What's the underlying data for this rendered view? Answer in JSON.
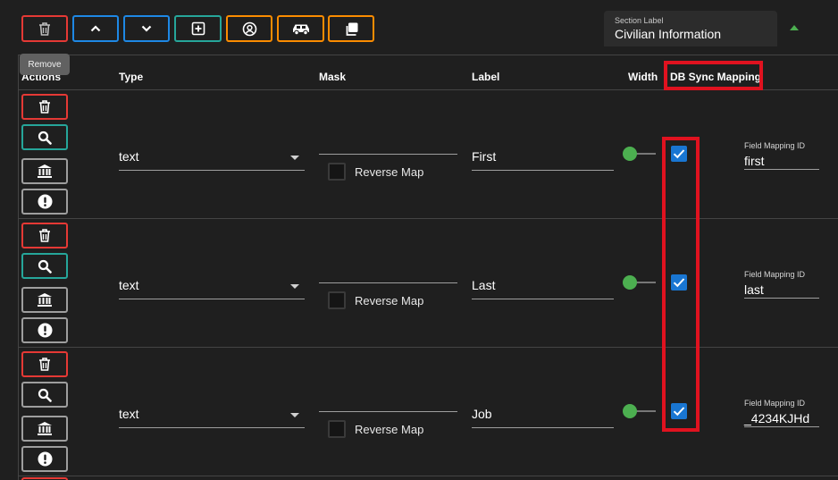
{
  "toolbar": {
    "buttons": [
      {
        "name": "delete-section-button",
        "icon": "trash-icon",
        "color": "#e53935"
      },
      {
        "name": "move-up-button",
        "icon": "chevron-up-icon",
        "color": "#1e88e5"
      },
      {
        "name": "move-down-button",
        "icon": "chevron-down-icon",
        "color": "#1e88e5"
      },
      {
        "name": "add-field-button",
        "icon": "plus-square-icon",
        "color": "#26a69a"
      },
      {
        "name": "person-button",
        "icon": "person-circle-icon",
        "color": "#fb8c00"
      },
      {
        "name": "vehicle-button",
        "icon": "car-icon",
        "color": "#fb8c00"
      },
      {
        "name": "copy-button",
        "icon": "copy-icon",
        "color": "#fb8c00"
      }
    ],
    "tooltip": "Remove"
  },
  "section_label": {
    "caption": "Section Label",
    "value": "Civilian Information"
  },
  "headers": {
    "actions": "Actions",
    "type": "Type",
    "mask": "Mask",
    "label": "Label",
    "width": "Width",
    "db_sync": "DB Sync Mapping"
  },
  "row_actions": [
    {
      "name": "delete-field-button",
      "icon": "trash-icon",
      "color": "#e53935"
    },
    {
      "name": "search-field-button",
      "icon": "search-icon",
      "color": "#26a69a"
    },
    {
      "name": "bank-field-button",
      "icon": "bank-icon",
      "color": "#9e9e9e"
    },
    {
      "name": "required-field-button",
      "icon": "exclamation-icon",
      "color": "#9e9e9e"
    }
  ],
  "rows": [
    {
      "type": "text",
      "reverse_map_label": "Reverse Map",
      "reverse_map": false,
      "label": "First",
      "db_sync": true,
      "field_mapping_caption": "Field Mapping ID",
      "field_mapping_id": "first",
      "search_active": true
    },
    {
      "type": "text",
      "reverse_map_label": "Reverse Map",
      "reverse_map": false,
      "label": "Last",
      "db_sync": true,
      "field_mapping_caption": "Field Mapping ID",
      "field_mapping_id": "last",
      "search_active": true
    },
    {
      "type": "text",
      "reverse_map_label": "Reverse Map",
      "reverse_map": false,
      "label": "Job",
      "db_sync": true,
      "field_mapping_caption": "Field Mapping ID",
      "field_mapping_id": "_4234KJHd",
      "search_active": false
    }
  ],
  "colors": {
    "highlight": "#e0121f",
    "accent_green": "#4caf50",
    "checkbox_blue": "#1976d2"
  }
}
